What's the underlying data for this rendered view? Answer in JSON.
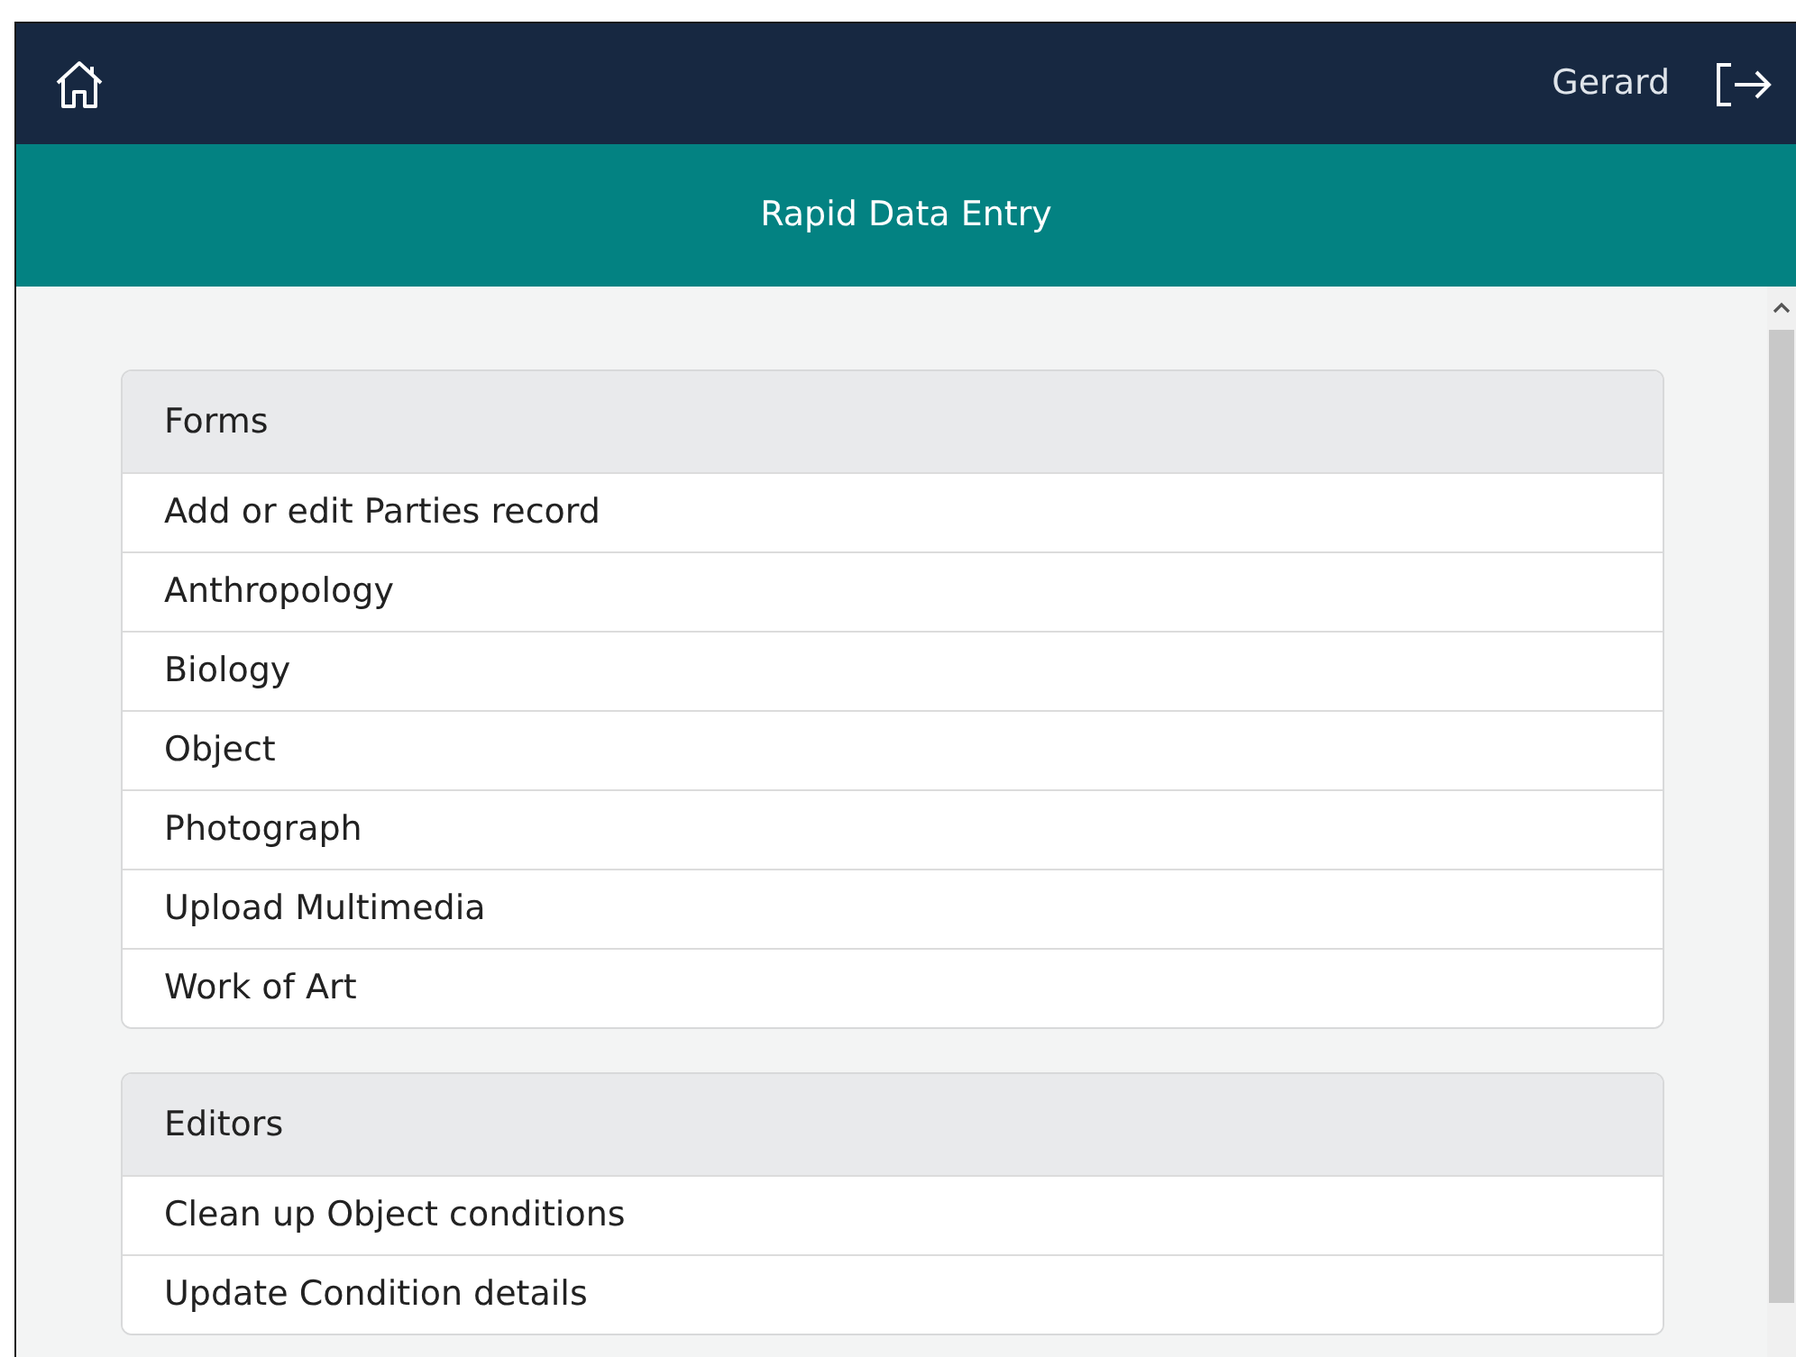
{
  "navbar": {
    "user": "Gerard"
  },
  "header": {
    "title": "Rapid Data Entry"
  },
  "sections": [
    {
      "title": "Forms",
      "items": [
        "Add or edit Parties record",
        "Anthropology",
        "Biology",
        "Object",
        "Photograph",
        "Upload Multimedia",
        "Work of Art"
      ]
    },
    {
      "title": "Editors",
      "items": [
        "Clean up Object conditions",
        "Update Condition details"
      ]
    }
  ]
}
